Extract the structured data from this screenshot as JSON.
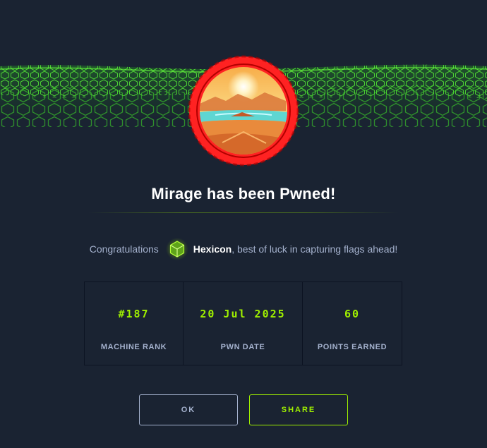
{
  "header": {
    "title": "Mirage has been Pwned!"
  },
  "congrats": {
    "prefix": "Congratulations",
    "username": "Hexicon",
    "suffix": ", best of luck in capturing flags ahead!",
    "user_icon": "hexagon-cube-icon"
  },
  "stats": [
    {
      "value": "#187",
      "label": "MACHINE RANK"
    },
    {
      "value": "20 Jul 2025",
      "label": "PWN DATE"
    },
    {
      "value": "60",
      "label": "POINTS EARNED"
    }
  ],
  "buttons": {
    "ok_label": "OK",
    "share_label": "SHARE"
  },
  "colors": {
    "background": "#1a2332",
    "accent": "#9fef00",
    "muted": "#a4b1cd",
    "avatar_ring": "#ff2222"
  },
  "icons": {
    "banner": "green-hexagon-wave-banner",
    "avatar": "desert-oasis-machine-avatar"
  }
}
